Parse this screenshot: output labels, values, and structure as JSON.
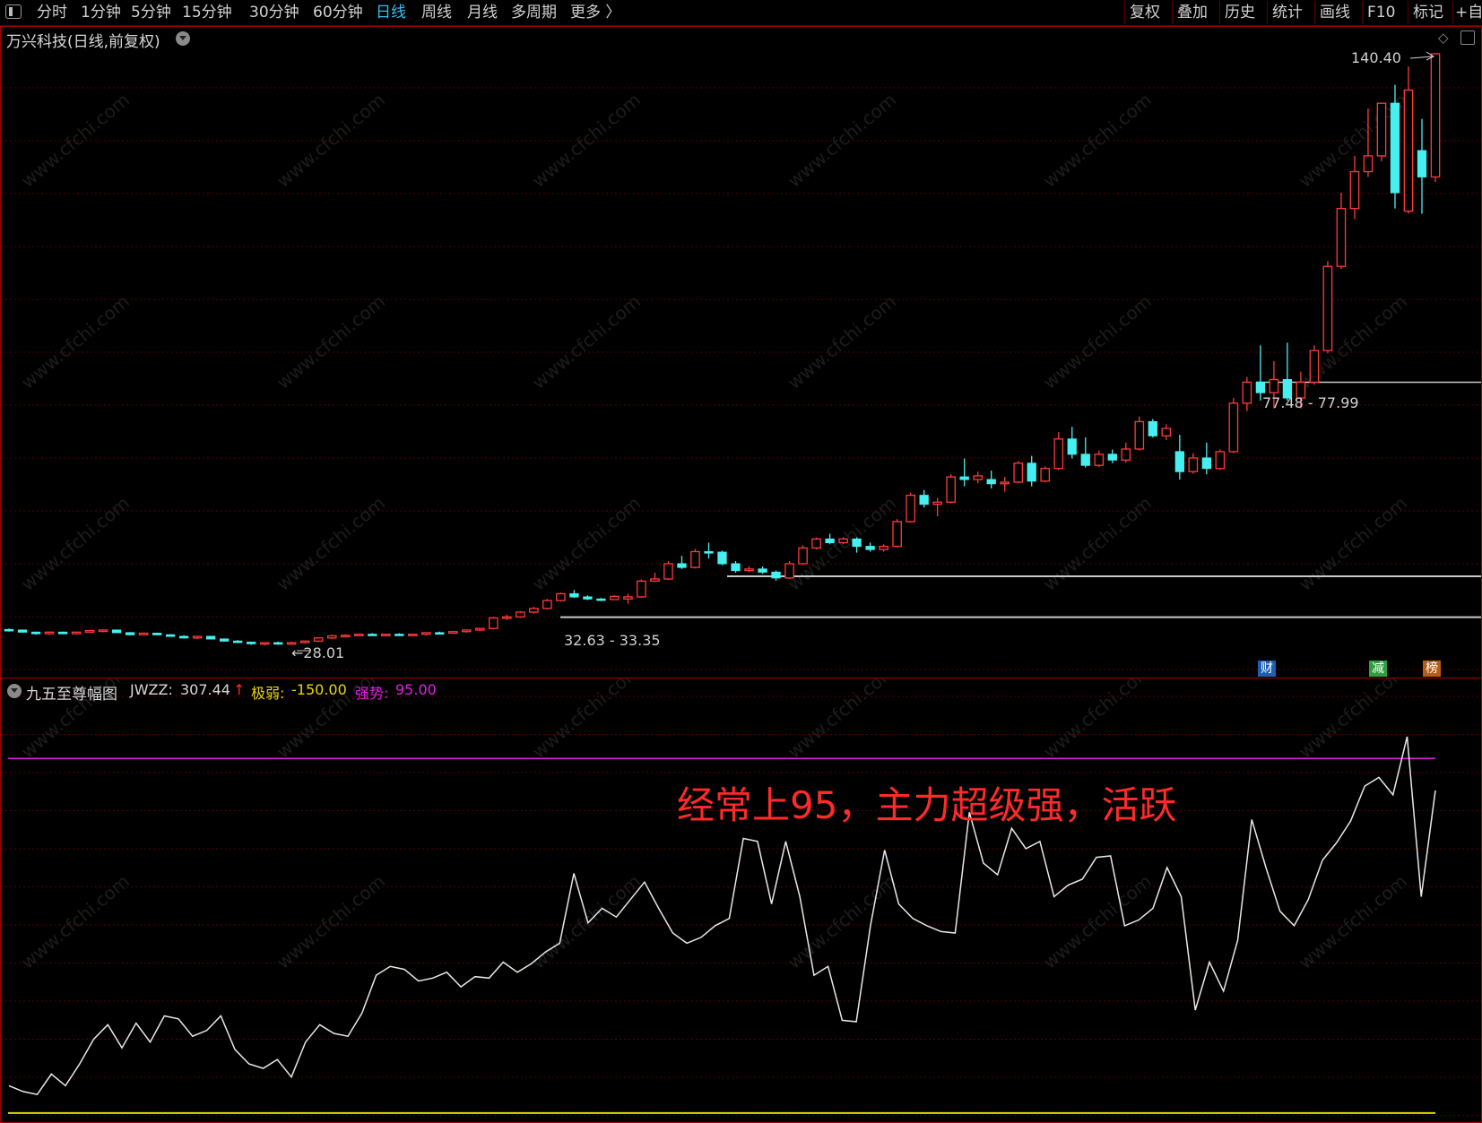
{
  "toolbar": {
    "periods": [
      "分时",
      "1分钟",
      "5分钟",
      "15分钟",
      "30分钟",
      "60分钟",
      "日线",
      "周线",
      "月线",
      "多周期",
      "更多 〉"
    ],
    "active_period": "日线",
    "right_buttons": [
      "复权",
      "叠加",
      "历史",
      "统计",
      "画线",
      "F10",
      "标记",
      "+自"
    ]
  },
  "main_chart": {
    "title": "万兴科技(日线,前复权)",
    "high_label": "140.40",
    "low_label": "←28.01",
    "range_label_1": "32.63 - 33.35",
    "range_label_2": "77.48 - 77.99",
    "badges": [
      {
        "text": "财",
        "color": "#1f5fb0"
      },
      {
        "text": "减",
        "color": "#2e9e3e"
      },
      {
        "text": "榜",
        "color": "#b85c10"
      }
    ]
  },
  "indicator": {
    "name": "九五至尊幅图",
    "jwzz_label": "JWZZ:",
    "jwzz_value": "307.44",
    "jiruo_label": "极弱:",
    "jiruo_value": "-150.00",
    "qiangshi_label": "强势:",
    "qiangshi_value": "95.00",
    "annotation": "经常上95，主力超级强，活跃",
    "colors": {
      "line": "#e8e8e8",
      "strong": "#e020e0",
      "weak": "#e8d800",
      "annotation": "#ff2a2a"
    }
  },
  "watermark": "www.cfchi.com",
  "chart_data": [
    {
      "type": "candlestick",
      "title": "万兴科技(日线,前复权)",
      "ylim": [
        20,
        145
      ],
      "price_ref_lines": [
        33.35,
        77.99
      ],
      "candles": [
        [
          31.0,
          31.2,
          30.6,
          30.9
        ],
        [
          30.9,
          31.0,
          30.4,
          30.5
        ],
        [
          30.5,
          30.6,
          30.0,
          30.2
        ],
        [
          30.2,
          30.6,
          30.0,
          30.5
        ],
        [
          30.5,
          30.6,
          30.1,
          30.2
        ],
        [
          30.2,
          30.6,
          30.1,
          30.5
        ],
        [
          30.5,
          30.9,
          30.4,
          30.8
        ],
        [
          30.8,
          31.0,
          30.5,
          30.9
        ],
        [
          30.9,
          31.0,
          30.3,
          30.4
        ],
        [
          30.4,
          30.5,
          29.9,
          30.0
        ],
        [
          30.0,
          30.4,
          29.9,
          30.3
        ],
        [
          30.3,
          30.4,
          29.9,
          30.0
        ],
        [
          30.0,
          30.1,
          29.6,
          29.7
        ],
        [
          29.7,
          29.9,
          29.3,
          29.4
        ],
        [
          29.4,
          29.8,
          29.2,
          29.7
        ],
        [
          29.7,
          29.8,
          29.1,
          29.2
        ],
        [
          29.2,
          29.3,
          28.7,
          28.8
        ],
        [
          28.8,
          29.0,
          28.5,
          28.6
        ],
        [
          28.6,
          28.7,
          28.1,
          28.3
        ],
        [
          28.3,
          28.6,
          28.01,
          28.5
        ],
        [
          28.5,
          28.7,
          28.1,
          28.4
        ],
        [
          28.4,
          28.7,
          28.2,
          28.5
        ],
        [
          28.5,
          28.9,
          28.3,
          28.8
        ],
        [
          28.8,
          29.5,
          28.6,
          29.4
        ],
        [
          29.4,
          30.0,
          29.2,
          29.8
        ],
        [
          29.8,
          30.1,
          29.6,
          29.9
        ],
        [
          29.9,
          30.2,
          29.7,
          30.1
        ],
        [
          30.1,
          30.3,
          29.8,
          29.9
        ],
        [
          29.9,
          30.2,
          29.7,
          30.1
        ],
        [
          30.1,
          30.3,
          29.8,
          29.9
        ],
        [
          29.9,
          30.2,
          29.7,
          30.1
        ],
        [
          30.1,
          30.5,
          29.9,
          30.4
        ],
        [
          30.4,
          30.6,
          30.1,
          30.3
        ],
        [
          30.3,
          30.7,
          30.2,
          30.6
        ],
        [
          30.6,
          31.0,
          30.4,
          30.9
        ],
        [
          30.9,
          31.3,
          30.7,
          31.2
        ],
        [
          31.2,
          33.4,
          31.0,
          33.2
        ],
        [
          33.2,
          33.8,
          32.8,
          33.4
        ],
        [
          33.4,
          34.5,
          33.2,
          34.3
        ],
        [
          34.3,
          35.3,
          34.0,
          35.0
        ],
        [
          35.0,
          36.8,
          34.8,
          36.5
        ],
        [
          36.5,
          38.0,
          36.3,
          37.8
        ],
        [
          37.8,
          38.5,
          37.0,
          37.2
        ],
        [
          37.2,
          37.5,
          36.6,
          36.8
        ],
        [
          36.8,
          37.0,
          36.4,
          36.7
        ],
        [
          36.7,
          37.5,
          36.6,
          37.3
        ],
        [
          36.8,
          37.8,
          35.9,
          37.2
        ],
        [
          37.2,
          40.5,
          37.0,
          40.2
        ],
        [
          40.2,
          41.8,
          40.0,
          40.6
        ],
        [
          40.6,
          44.0,
          40.4,
          43.5
        ],
        [
          43.5,
          45.0,
          42.5,
          42.8
        ],
        [
          42.8,
          46.3,
          42.6,
          45.8
        ],
        [
          45.8,
          47.5,
          44.5,
          45.7
        ],
        [
          45.7,
          46.0,
          43.2,
          43.5
        ],
        [
          43.5,
          44.0,
          41.8,
          42.2
        ],
        [
          42.2,
          43.0,
          41.9,
          42.5
        ],
        [
          42.5,
          43.0,
          41.6,
          41.9
        ],
        [
          41.9,
          42.2,
          40.3,
          40.8
        ],
        [
          40.8,
          44.0,
          40.6,
          43.5
        ],
        [
          43.5,
          47.0,
          43.3,
          46.5
        ],
        [
          46.5,
          48.5,
          46.2,
          48.2
        ],
        [
          48.2,
          49.2,
          47.2,
          47.5
        ],
        [
          47.5,
          48.5,
          47.2,
          48.2
        ],
        [
          48.2,
          48.5,
          45.6,
          46.8
        ],
        [
          46.8,
          47.5,
          45.8,
          46.2
        ],
        [
          46.2,
          47.2,
          45.8,
          46.8
        ],
        [
          46.8,
          52.0,
          46.6,
          51.5
        ],
        [
          51.5,
          57.0,
          51.3,
          56.5
        ],
        [
          56.5,
          57.5,
          54.2,
          54.8
        ],
        [
          54.8,
          56.0,
          52.5,
          55.2
        ],
        [
          55.2,
          60.5,
          55.0,
          60.0
        ],
        [
          60.0,
          63.5,
          58.2,
          59.5
        ],
        [
          59.5,
          61.0,
          58.8,
          60.2
        ],
        [
          59.5,
          61.2,
          57.8,
          58.7
        ],
        [
          58.7,
          60.0,
          57.2,
          59.0
        ],
        [
          59.0,
          63.0,
          58.8,
          62.6
        ],
        [
          62.6,
          64.0,
          58.2,
          59.2
        ],
        [
          59.2,
          62.0,
          59.0,
          61.6
        ],
        [
          61.6,
          68.5,
          61.3,
          67.2
        ],
        [
          67.2,
          69.5,
          63.5,
          64.3
        ],
        [
          64.3,
          67.5,
          61.8,
          62.2
        ],
        [
          62.2,
          65.0,
          61.9,
          64.3
        ],
        [
          64.3,
          65.2,
          62.6,
          63.2
        ],
        [
          63.2,
          66.5,
          62.7,
          65.3
        ],
        [
          65.3,
          71.5,
          65.0,
          70.5
        ],
        [
          70.5,
          71.0,
          67.5,
          67.8
        ],
        [
          67.8,
          70.0,
          67.0,
          69.2
        ],
        [
          64.8,
          68.0,
          59.5,
          61.0
        ],
        [
          61.0,
          64.5,
          60.6,
          63.6
        ],
        [
          63.6,
          66.5,
          60.5,
          61.6
        ],
        [
          61.6,
          65.2,
          61.3,
          64.8
        ],
        [
          64.8,
          75.0,
          64.5,
          74.0
        ],
        [
          74.0,
          79.0,
          72.5,
          78.0
        ],
        [
          78.0,
          85.0,
          74.5,
          76.0
        ],
        [
          76.0,
          82.0,
          73.0,
          78.5
        ],
        [
          78.5,
          85.5,
          74.5,
          75.0
        ],
        [
          75.0,
          80.0,
          73.0,
          78.0
        ],
        [
          78.0,
          85.0,
          77.5,
          84.0
        ],
        [
          84.0,
          101.0,
          83.5,
          100.0
        ],
        [
          100.0,
          114.0,
          99.5,
          111.0
        ],
        [
          111.0,
          121.0,
          109.0,
          118.0
        ],
        [
          118.0,
          130.0,
          117.0,
          121.0
        ],
        [
          121.0,
          130.0,
          120.0,
          131.0
        ],
        [
          131.0,
          134.5,
          111.0,
          114.0
        ],
        [
          110.5,
          138.0,
          110.0,
          133.5
        ],
        [
          122.0,
          128.0,
          110.0,
          117.0
        ],
        [
          117.0,
          140.4,
          116.0,
          140.4
        ]
      ]
    },
    {
      "type": "line",
      "title": "九五至尊幅图",
      "series": [
        {
          "name": "JWZZ",
          "values": [
            -130,
            -134,
            -136,
            -122,
            -130,
            -115,
            -98,
            -88,
            -104,
            -87,
            -100,
            -82,
            -84,
            -96,
            -92,
            -82,
            -105,
            -115,
            -118,
            -112,
            -124,
            -100,
            -88,
            -94,
            -96,
            -80,
            -54,
            -48,
            -50,
            -58,
            -56,
            -52,
            -62,
            -55,
            -56,
            -45,
            -52,
            -46,
            -38,
            -32,
            16,
            -18,
            -8,
            -14,
            -2,
            10,
            -8,
            -25,
            -32,
            -28,
            -20,
            -15,
            40,
            38,
            -5,
            38,
            0,
            -54,
            -48,
            -85,
            -86,
            -20,
            32,
            -5,
            -15,
            -20,
            -24,
            -25,
            58,
            23,
            15,
            47,
            33,
            38,
            0,
            8,
            12,
            27,
            28,
            -20,
            -16,
            -8,
            20,
            0,
            -78,
            -45,
            -65,
            -30,
            53,
            20,
            -10,
            -20,
            -2,
            25,
            37,
            52,
            76,
            82,
            70,
            110,
            0,
            73
          ]
        },
        {
          "name": "强势",
          "values": [
            95
          ]
        },
        {
          "name": "极弱",
          "values": [
            -150
          ]
        }
      ],
      "last_value": 307.44,
      "ylim": [
        -155,
        150
      ]
    }
  ]
}
